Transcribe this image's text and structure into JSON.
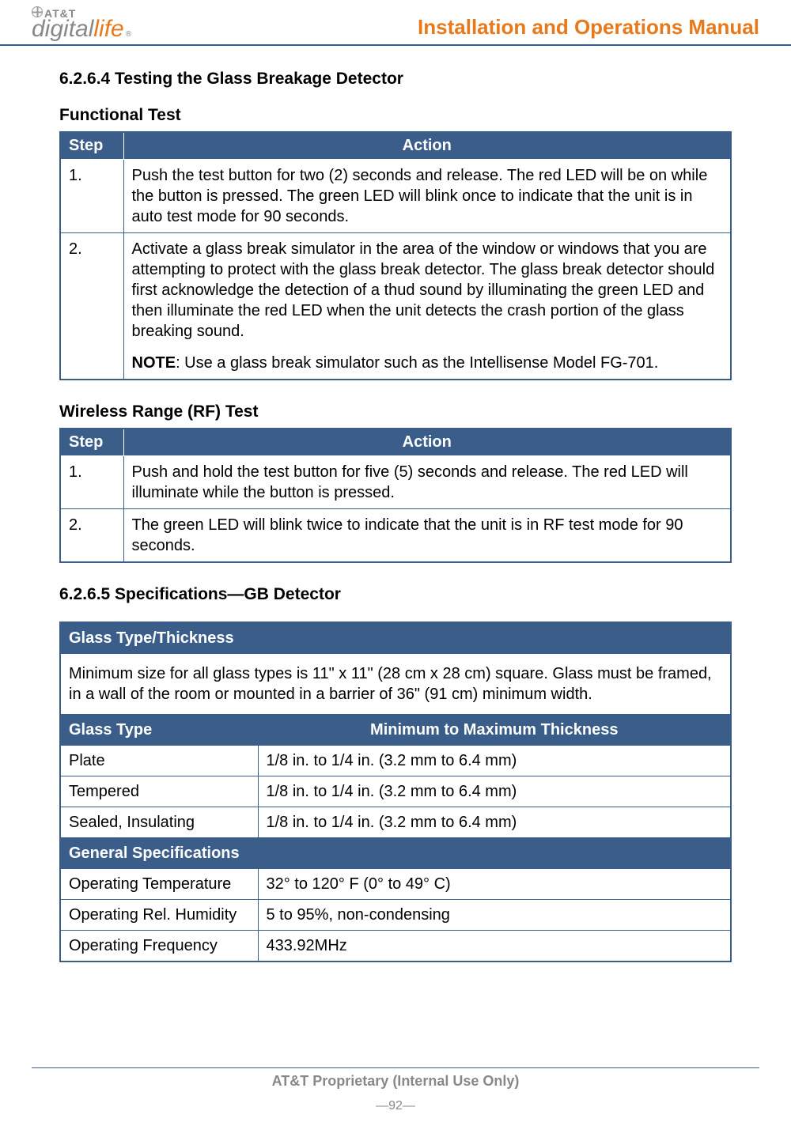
{
  "header": {
    "logo_top": "AT&T",
    "logo_main1": "digital",
    "logo_main2": "life",
    "logo_reg": "®",
    "manual_title": "Installation and Operations Manual"
  },
  "section1": {
    "number_title": "6.2.6.4  Testing the Glass Breakage Detector",
    "functional_title": "Functional Test",
    "col_step": "Step",
    "col_action": "Action",
    "r1_step": "1.",
    "r1_action": "Push the test button for two (2) seconds and release. The red LED will be on while the button is pressed. The green LED will blink once to indicate that the unit is in auto test mode for 90 seconds.",
    "r2_step": "2.",
    "r2_action": "Activate a glass break simulator in the area of the window or windows that you are attempting to protect with the glass break detector. The glass break detector should first acknowledge the detection of a thud sound by illuminating the green LED and then illuminate the red LED when the unit detects the crash portion of the glass breaking sound.",
    "r2_note_label": "NOTE",
    "r2_note_text": ": Use a glass break simulator such as the Intellisense Model FG-701."
  },
  "section_rf": {
    "title": "Wireless Range (RF) Test",
    "col_step": "Step",
    "col_action": "Action",
    "r1_step": "1.",
    "r1_action": "Push and hold the test button for five (5) seconds and release. The red LED will illuminate while the button is pressed.",
    "r2_step": "2.",
    "r2_action": "The green LED will blink twice to indicate that the unit is in RF test mode for 90 seconds."
  },
  "section_spec": {
    "number_title": "6.2.6.5  Specifications—GB Detector",
    "glass_header": "Glass Type/Thickness",
    "glass_desc": "Minimum size for all glass types is 11\" x 11\" (28 cm x 28 cm) square. Glass must be framed, in a wall of the room or mounted in a barrier of 36\" (91 cm) minimum width.",
    "col_type": "Glass Type",
    "col_thickness": "Minimum to Maximum Thickness",
    "rows": [
      {
        "type": "Plate",
        "val": "1/8 in. to 1/4 in. (3.2 mm to 6.4 mm)"
      },
      {
        "type": "Tempered",
        "val": "1/8 in. to 1/4 in. (3.2 mm to 6.4 mm)"
      },
      {
        "type": "Sealed, Insulating",
        "val": "1/8 in. to 1/4 in. (3.2 mm to 6.4 mm)"
      }
    ],
    "general_header": "General Specifications",
    "gen": [
      {
        "k": "Operating Temperature",
        "v": "32° to 120° F  (0° to 49° C)"
      },
      {
        "k": "Operating Rel. Humidity",
        "v": "5 to 95%, non-condensing"
      },
      {
        "k": "Operating Frequency",
        "v": "433.92MHz"
      }
    ]
  },
  "footer": {
    "proprietary": "AT&T Proprietary (Internal Use Only)",
    "page": "—92—"
  }
}
